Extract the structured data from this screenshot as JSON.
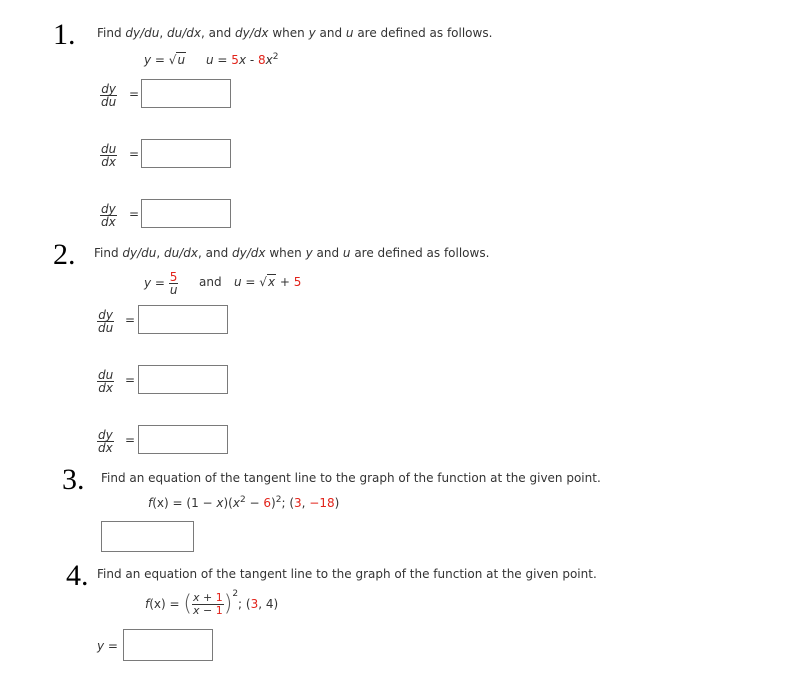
{
  "questions": [
    {
      "number": "1.",
      "prompt_prefix": "Find ",
      "d1": "dy/du",
      "sep1": ", ",
      "d2": "du/dx",
      "sep2": ", and ",
      "d3": "dy/dx",
      "prompt_mid": " when ",
      "var_y": "y",
      "prompt_and": " and ",
      "var_u": "u",
      "prompt_suffix": " are defined as follows.",
      "equations": {
        "y_label": "y",
        "equals": " = ",
        "y_radicand": "u",
        "u_label": "u",
        "u_coef1": "5",
        "u_var1": "x",
        "u_minus": " - ",
        "u_coef2": "8",
        "u_var2": "x",
        "u_exp": "2"
      },
      "answers": [
        {
          "num": "dy",
          "den": "du",
          "eq": "=",
          "value": ""
        },
        {
          "num": "du",
          "den": "dx",
          "eq": "=",
          "value": ""
        },
        {
          "num": "dy",
          "den": "dx",
          "eq": "=",
          "value": ""
        }
      ]
    },
    {
      "number": "2.",
      "prompt_prefix": "Find ",
      "d1": "dy/du",
      "sep1": ", ",
      "d2": "du/dx",
      "sep2": ", and ",
      "d3": "dy/dx",
      "prompt_mid": " when ",
      "var_y": "y",
      "prompt_and": " and ",
      "var_u": "u",
      "prompt_suffix": " are defined as follows.",
      "equations": {
        "y_label": "y",
        "equals": " = ",
        "y_num": "5",
        "y_den": "u",
        "and": "and",
        "u_label": "u",
        "u_radicand": "x",
        "u_plus": " + ",
        "u_const": "5"
      },
      "answers": [
        {
          "num": "dy",
          "den": "du",
          "eq": "=",
          "value": ""
        },
        {
          "num": "du",
          "den": "dx",
          "eq": "=",
          "value": ""
        },
        {
          "num": "dy",
          "den": "dx",
          "eq": "=",
          "value": ""
        }
      ]
    },
    {
      "number": "3.",
      "prompt": "Find an equation of the tangent line to the graph of the function at the given point.",
      "function": {
        "fname": "f",
        "fvar": "(x)",
        "equals": " = (1 − ",
        "x1": "x",
        "mid": ")(",
        "x2": "x",
        "exp1": "2",
        "minus": " − ",
        "c6": "6",
        "close": ")",
        "exp2": "2",
        "semi": "; (",
        "px": "3",
        "comma": ", ",
        "py": "−18",
        "end": ")"
      },
      "answer_value": ""
    },
    {
      "number": "4.",
      "prompt": "Find an equation of the tangent line to the graph of the function at the given point.",
      "function": {
        "fname": "f",
        "fvar": "(x)",
        "equals": " = ",
        "lparen": "(",
        "num_var": "x",
        "num_op": " + ",
        "num_c": "1",
        "den_var": "x",
        "den_op": " − ",
        "den_c": "1",
        "rparen": ")",
        "exp": "2",
        "semi": "; (",
        "px": "3",
        "comma": ", ",
        "py": "4",
        "end": ")"
      },
      "answer_label": "y",
      "answer_eq": " =",
      "answer_value": ""
    }
  ]
}
